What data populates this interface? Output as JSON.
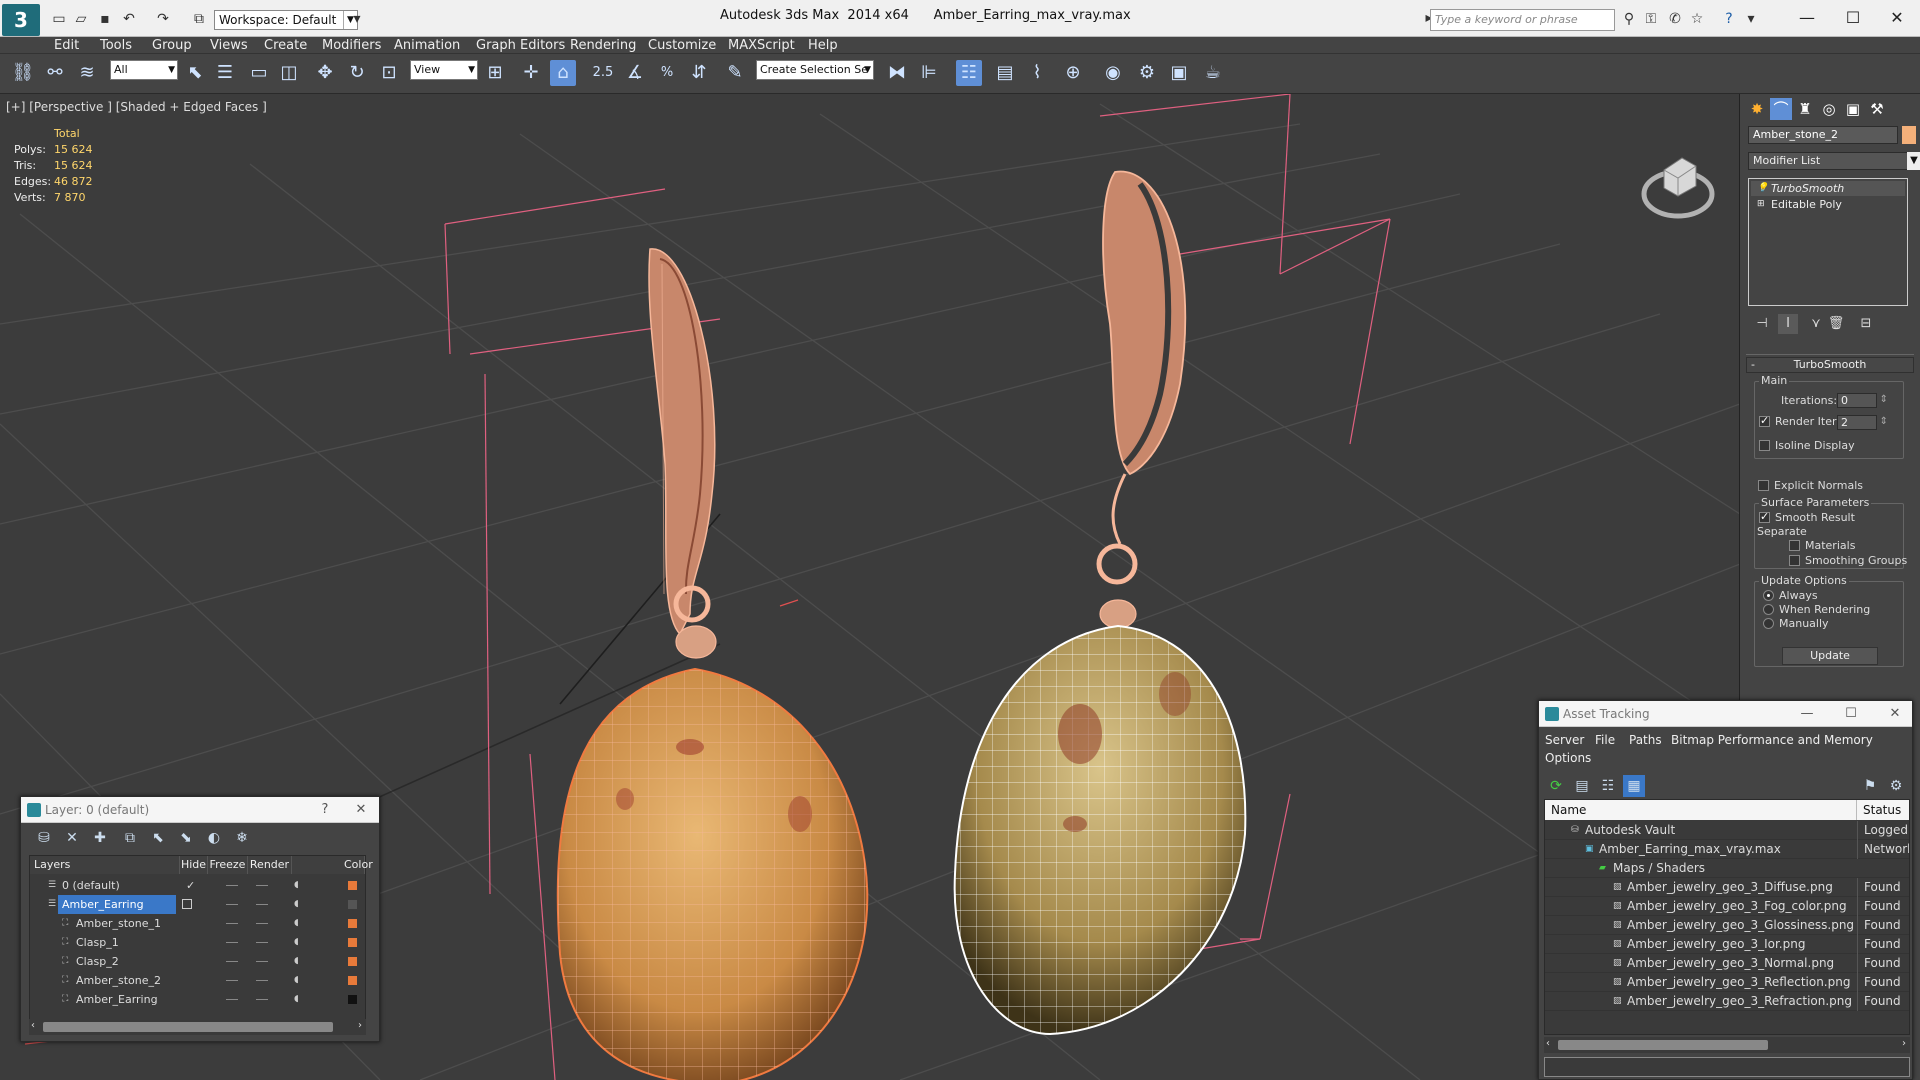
{
  "titlebar": {
    "app_title": "Autodesk 3ds Max  2014 x64      Amber_Earring_max_vray.max",
    "workspace": "Workspace: Default",
    "search_placeholder": "Type a keyword or phrase",
    "minimize": "—",
    "maximize": "☐",
    "close": "✕"
  },
  "menu": [
    "Edit",
    "Tools",
    "Group",
    "Views",
    "Create",
    "Modifiers",
    "Animation",
    "Graph Editors",
    "Rendering",
    "Customize",
    "MAXScript",
    "Help"
  ],
  "toolbar": {
    "selection_filter": "All",
    "ref_coord": "View",
    "angle_snap": "2.5",
    "named_selection": "Create Selection Se"
  },
  "viewport": {
    "label": "[+] [Perspective ] [Shaded + Edged Faces ]",
    "stats": {
      "header": "Total",
      "rows": [
        {
          "k": "Polys:",
          "v": "15 624"
        },
        {
          "k": "Tris:",
          "v": "15 624"
        },
        {
          "k": "Edges:",
          "v": "46 872"
        },
        {
          "k": "Verts:",
          "v": "7 870"
        }
      ]
    }
  },
  "command_panel": {
    "object_name": "Amber_stone_2",
    "object_color": "#f4b07a",
    "modifier_list": "Modifier List",
    "stack": [
      "TurboSmooth",
      "Editable Poly"
    ],
    "rollout_title": "TurboSmooth",
    "main_label": "Main",
    "iterations_label": "Iterations:",
    "iterations_value": "0",
    "render_iters_label": "Render Iters:",
    "render_iters_value": "2",
    "isoline": "Isoline Display",
    "explicit_normals": "Explicit Normals",
    "surface_params": "Surface Parameters",
    "smooth_result": "Smooth Result",
    "separate": "Separate",
    "materials": "Materials",
    "smoothing_groups": "Smoothing Groups",
    "update_options": "Update Options",
    "always": "Always",
    "when_rendering": "When Rendering",
    "manually": "Manually",
    "update_button": "Update"
  },
  "layer_window": {
    "title": "Layer: 0 (default)",
    "help": "?",
    "close": "✕",
    "headers": [
      "Layers",
      "Hide",
      "Freeze",
      "Render",
      "Color"
    ],
    "rows": [
      {
        "name": "0 (default)",
        "color": "#e87a3a"
      },
      {
        "name": "Amber_Earring",
        "color": "#555555"
      },
      {
        "name": "Amber_stone_1",
        "color": "#e87a3a"
      },
      {
        "name": "Clasp_1",
        "color": "#e87a3a"
      },
      {
        "name": "Clasp_2",
        "color": "#e87a3a"
      },
      {
        "name": "Amber_stone_2",
        "color": "#e87a3a"
      },
      {
        "name": "Amber_Earring",
        "color": "#111111"
      }
    ]
  },
  "asset_window": {
    "title": "Asset Tracking",
    "menu": [
      "Server",
      "File",
      "Paths",
      "Bitmap Performance and Memory",
      "Options"
    ],
    "headers": [
      "Name",
      "Status"
    ],
    "rows": [
      {
        "name": "Autodesk Vault",
        "status": "Logged Ou"
      },
      {
        "name": "Amber_Earring_max_vray.max",
        "status": "Network"
      },
      {
        "name": "Maps / Shaders",
        "status": ""
      },
      {
        "name": "Amber_jewelry_geo_3_Diffuse.png",
        "status": "Found"
      },
      {
        "name": "Amber_jewelry_geo_3_Fog_color.png",
        "status": "Found"
      },
      {
        "name": "Amber_jewelry_geo_3_Glossiness.png",
        "status": "Found"
      },
      {
        "name": "Amber_jewelry_geo_3_Ior.png",
        "status": "Found"
      },
      {
        "name": "Amber_jewelry_geo_3_Normal.png",
        "status": "Found"
      },
      {
        "name": "Amber_jewelry_geo_3_Reflection.png",
        "status": "Found"
      },
      {
        "name": "Amber_jewelry_geo_3_Refraction.png",
        "status": "Found"
      }
    ]
  },
  "colors": {
    "selection_blue": "#3a78c8",
    "bbox_pink": "#e06080",
    "stat_yellow": "#ffd66b"
  }
}
